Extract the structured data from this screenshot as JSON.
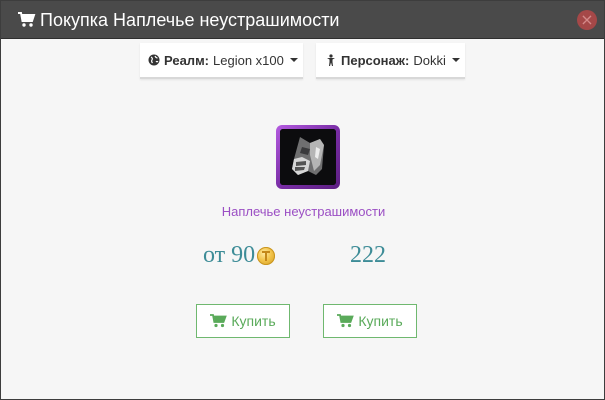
{
  "modal": {
    "title": "Покупка Наплечье неустрашимости",
    "close_label": "×"
  },
  "selectors": {
    "realm": {
      "label": "Реалм:",
      "value": "Legion x100"
    },
    "character": {
      "label": "Персонаж:",
      "value": "Dokki"
    }
  },
  "item": {
    "name": "Наплечье неустрашимости",
    "frame_color": "#a64fd1",
    "name_color": "#9b4fc4"
  },
  "prices": {
    "from_prefix": "от",
    "from_value": "90",
    "alt_value": "222",
    "color": "#3d8c97"
  },
  "buttons": {
    "buy_label_1": "Купить",
    "buy_label_2": "Купить",
    "color": "#5aaa5a"
  },
  "icons": {
    "header": "shopping-cart-icon",
    "realm": "globe-icon",
    "character": "person-icon",
    "currency": "coin-icon",
    "button": "shopping-cart-icon"
  }
}
